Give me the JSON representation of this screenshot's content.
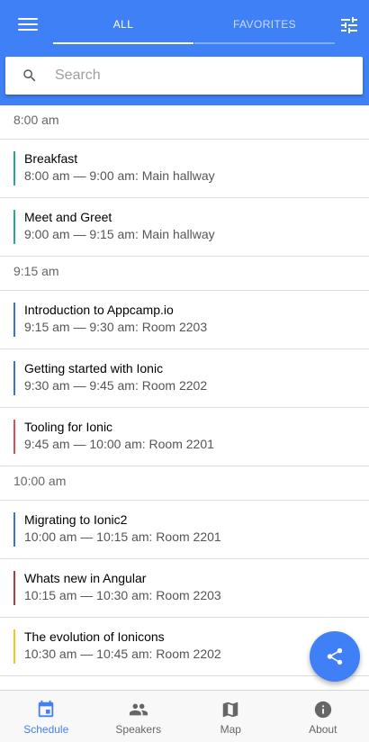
{
  "colors": {
    "primary": "#3f80f7",
    "teal": "#26a69a",
    "blue": "#3f6ed8",
    "red": "#e04e4e",
    "darkred": "#b03a3a",
    "yellow": "#f5c518"
  },
  "header": {
    "menu_icon": "menu-icon",
    "filter_icon": "tune-icon",
    "segments": [
      {
        "label": "ALL",
        "selected": true
      },
      {
        "label": "FAVORITES",
        "selected": false
      }
    ]
  },
  "search": {
    "placeholder": "Search",
    "value": ""
  },
  "schedule": [
    {
      "time": "8:00 am",
      "sessions": [
        {
          "title": "Breakfast",
          "detail": "8:00 am — 9:00 am: Main hallway",
          "color": "#26a69a"
        },
        {
          "title": "Meet and Greet",
          "detail": "9:00 am — 9:15 am: Main hallway",
          "color": "#26a69a"
        }
      ]
    },
    {
      "time": "9:15 am",
      "sessions": [
        {
          "title": "Introduction to Appcamp.io",
          "detail": "9:15 am — 9:30 am: Room 2203",
          "color": "#3f6ed8"
        },
        {
          "title": "Getting started with Ionic",
          "detail": "9:30 am — 9:45 am: Room 2202",
          "color": "#3f6ed8"
        },
        {
          "title": "Tooling for Ionic",
          "detail": "9:45 am — 10:00 am: Room 2201",
          "color": "#e04e4e"
        }
      ]
    },
    {
      "time": "10:00 am",
      "sessions": [
        {
          "title": "Migrating to Ionic2",
          "detail": "10:00 am — 10:15 am: Room 2201",
          "color": "#3f6ed8"
        },
        {
          "title": "Whats new in Angular",
          "detail": "10:15 am — 10:30 am: Room 2203",
          "color": "#b03a3a"
        },
        {
          "title": "The evolution of Ionicons",
          "detail": "10:30 am — 10:45 am: Room 2202",
          "color": "#f5c518"
        }
      ]
    }
  ],
  "fab": {
    "icon": "share-icon"
  },
  "tabs": [
    {
      "label": "Schedule",
      "icon": "calendar-icon",
      "active": true
    },
    {
      "label": "Speakers",
      "icon": "people-icon",
      "active": false
    },
    {
      "label": "Map",
      "icon": "map-icon",
      "active": false
    },
    {
      "label": "About",
      "icon": "info-icon",
      "active": false
    }
  ]
}
